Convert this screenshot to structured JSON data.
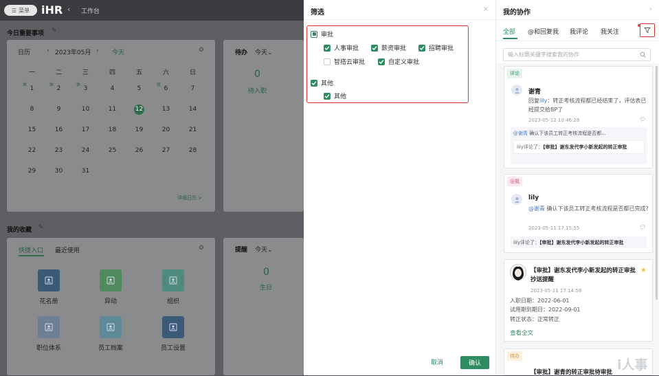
{
  "topbar": {
    "menu_label": "菜单",
    "logo": "iHR",
    "breadcrumb": "工作台"
  },
  "dashboard": {
    "important_title": "今日重要事项",
    "calendar": {
      "label": "日历",
      "month": "2023年05月",
      "today_btn": "今天",
      "weekdays": [
        "一",
        "二",
        "三",
        "四",
        "五",
        "六",
        "日"
      ],
      "rows": [
        [
          {
            "d": "1",
            "s": "休"
          },
          {
            "d": "2",
            "s": "休"
          },
          {
            "d": "3",
            "s": "休"
          },
          {
            "d": "4",
            "s": ""
          },
          {
            "d": "5",
            "s": ""
          },
          {
            "d": "6",
            "s": "班"
          },
          {
            "d": "7",
            "s": ""
          }
        ],
        [
          {
            "d": "8",
            "s": ""
          },
          {
            "d": "9",
            "s": ""
          },
          {
            "d": "10",
            "s": ""
          },
          {
            "d": "11",
            "s": ""
          },
          {
            "d": "12",
            "s": "",
            "today": true
          },
          {
            "d": "13",
            "s": ""
          },
          {
            "d": "14",
            "s": ""
          }
        ],
        [
          {
            "d": "15",
            "s": ""
          },
          {
            "d": "16",
            "s": ""
          },
          {
            "d": "17",
            "s": ""
          },
          {
            "d": "18",
            "s": ""
          },
          {
            "d": "19",
            "s": ""
          },
          {
            "d": "20",
            "s": ""
          },
          {
            "d": "21",
            "s": ""
          }
        ],
        [
          {
            "d": "22",
            "s": ""
          },
          {
            "d": "23",
            "s": ""
          },
          {
            "d": "24",
            "s": ""
          },
          {
            "d": "25",
            "s": ""
          },
          {
            "d": "26",
            "s": ""
          },
          {
            "d": "27",
            "s": ""
          },
          {
            "d": "28",
            "s": ""
          }
        ],
        [
          {
            "d": "29",
            "s": ""
          },
          {
            "d": "30",
            "s": ""
          },
          {
            "d": "31",
            "s": ""
          }
        ]
      ],
      "detail_link": "详细日历 >"
    },
    "todo": {
      "label": "待办",
      "range": "今天",
      "count": "0",
      "item": "待入职"
    },
    "fav_title": "我的收藏",
    "fav": {
      "tab_quick": "快捷入口",
      "tab_recent": "最近使用",
      "tiles": [
        {
          "label": "花名册",
          "color": "#3b5a7a"
        },
        {
          "label": "异动",
          "color": "#4f8a5f"
        },
        {
          "label": "组织",
          "color": "#4f8a7e"
        },
        {
          "label": "职位体系",
          "color": "#6d7f95"
        },
        {
          "label": "员工档案",
          "color": "#5d8a96"
        },
        {
          "label": "员工设置",
          "color": "#3b5a7a"
        }
      ]
    },
    "remind": {
      "label": "提醒",
      "range": "今天",
      "count": "0",
      "item": "生日"
    }
  },
  "filter": {
    "title": "筛选",
    "close": "×",
    "group1": {
      "label": "审批",
      "items": [
        {
          "label": "人事审批",
          "checked": true
        },
        {
          "label": "薪资审批",
          "checked": true
        },
        {
          "label": "招聘审批",
          "checked": true
        },
        {
          "label": "智搭云审批",
          "checked": false
        },
        {
          "label": "自定义审批",
          "checked": true
        }
      ]
    },
    "group2": {
      "label": "其他",
      "items": [
        {
          "label": "其他",
          "checked": true
        }
      ]
    },
    "cancel": "取消",
    "confirm": "确认"
  },
  "collab": {
    "title": "我的协作",
    "tabs": [
      "全部",
      "@和回复我",
      "我评论",
      "我关注"
    ],
    "search_placeholder": "输入标题关键字搜索我的协作",
    "cards": {
      "c1": {
        "tag": "评论",
        "user": "谢青",
        "reply_prefix": "回复",
        "reply_to": "lily",
        "text": "：转正考核流程都已经结束了，评估表已经提交给BP了",
        "time": "2023-05-12 10:46:28",
        "quote_mention": "@谢青",
        "quote_text": " 确认下该员工转正考核流程是否都...",
        "quote_inner_prefix": "lily评论了：",
        "quote_inner_bold": "【审批】谢东发代李小新发起的转正审批"
      },
      "c2": {
        "tag": "@我",
        "user": "lily",
        "mention": "@谢青",
        "text": " 确认下该员工转正考核流程是否都已完成?",
        "time": "2023-05-11 17:15:55",
        "quote_prefix": "lily评论了：",
        "quote_bold": "【审批】谢东发代李小新发起的转正审批"
      },
      "c3": {
        "title": "【审批】谢东发代李小新发起的转正审批抄送提醒",
        "time": "2023-05-11 17:14:58",
        "f1": "入职日期：",
        "v1": "2022-06-01",
        "f2": "试用期到期日：",
        "v2": "2022-09-01",
        "f3": "转正状态：",
        "v3": "正常转正",
        "more": "查看全文"
      },
      "c4": {
        "tag": "待办",
        "title": "【审批】谢青的转正审批待审批"
      }
    },
    "watermark": "i人事"
  },
  "colors": {
    "brand": "#2f8b62",
    "highlight": "#d9342b"
  }
}
